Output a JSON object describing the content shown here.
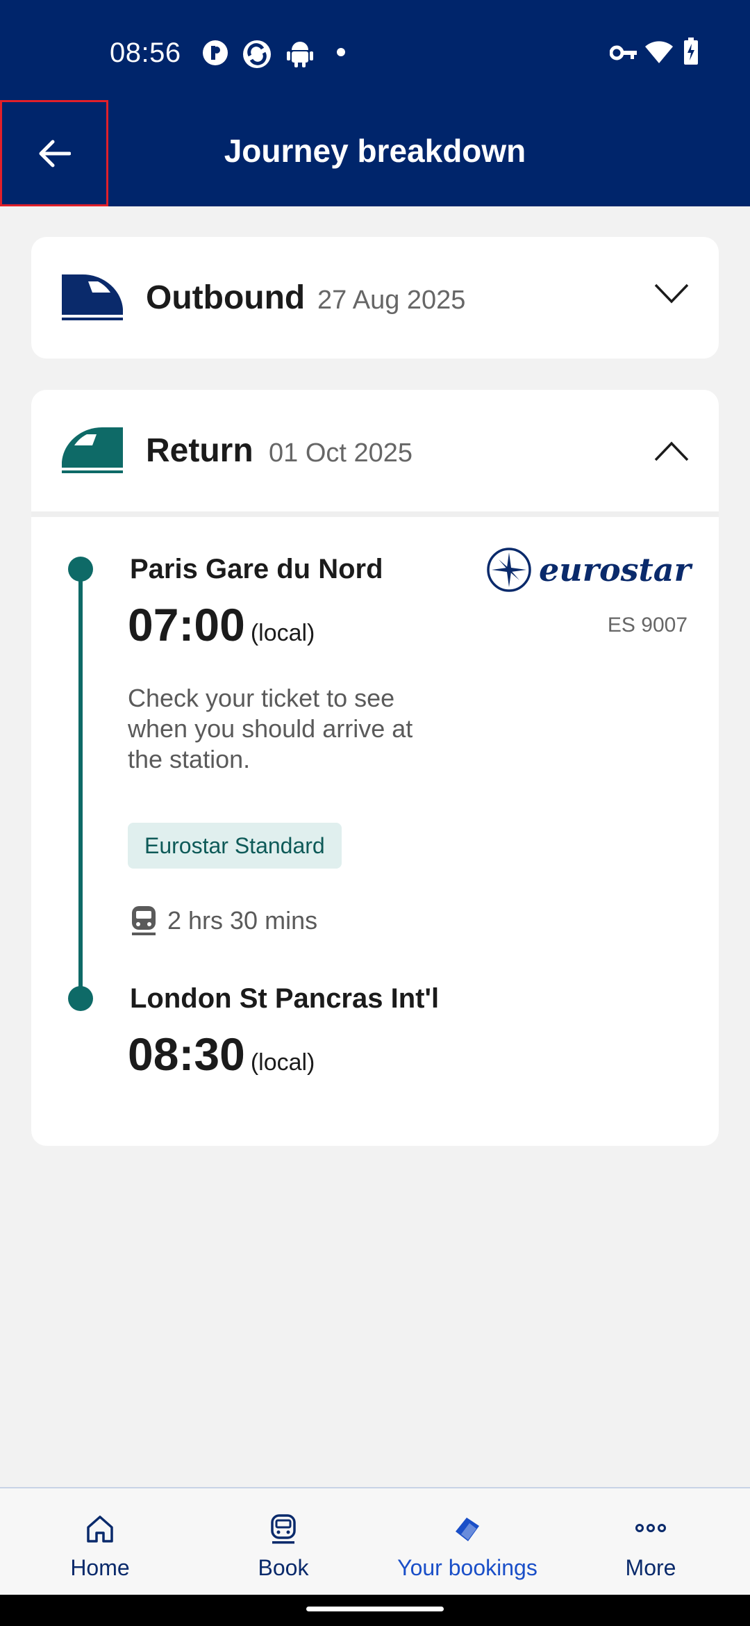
{
  "status_bar": {
    "time": "08:56",
    "icons": [
      "p-app-icon",
      "sync-app-icon",
      "android-icon",
      "notification-dot-icon",
      "vpn-key-icon",
      "wifi-icon",
      "battery-charging-icon"
    ]
  },
  "header": {
    "title": "Journey breakdown",
    "back_icon": "arrow-left-icon"
  },
  "outbound": {
    "label": "Outbound",
    "date": "27 Aug 2025",
    "expanded": false
  },
  "return": {
    "label": "Return",
    "date": "01 Oct 2025",
    "expanded": true,
    "departure": {
      "station": "Paris Gare du Nord",
      "time": "07:00",
      "time_note": "(local)",
      "note": "Check your ticket to see when you should arrive at the station."
    },
    "operator": {
      "name": "eurostar",
      "train_number": "ES 9007"
    },
    "class_badge": "Eurostar Standard",
    "duration": "2 hrs 30 mins",
    "arrival": {
      "station": "London St Pancras Int'l",
      "time": "08:30",
      "time_note": "(local)"
    }
  },
  "bottom_nav": {
    "items": [
      {
        "label": "Home",
        "icon": "home-icon",
        "active": false
      },
      {
        "label": "Book",
        "icon": "train-icon",
        "active": false
      },
      {
        "label": "Your bookings",
        "icon": "tickets-icon",
        "active": true
      },
      {
        "label": "More",
        "icon": "more-dots-icon",
        "active": false
      }
    ]
  },
  "colors": {
    "header_bg": "#00256b",
    "accent_teal": "#0e6a67",
    "outbound_icon": "#0a2a6b",
    "active_nav": "#1a4fc8",
    "back_highlight": "#e0202a"
  }
}
